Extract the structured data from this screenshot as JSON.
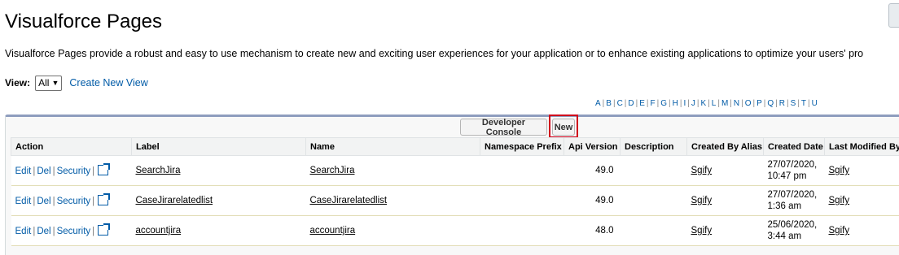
{
  "page": {
    "title": "Visualforce Pages",
    "description": "Visualforce Pages provide a robust and easy to use mechanism to create new and exciting user experiences for your application or to enhance existing applications to optimize your users' pro"
  },
  "view": {
    "label": "View:",
    "selected": "All",
    "create_link": "Create New View"
  },
  "alphabet": [
    "A",
    "B",
    "C",
    "D",
    "E",
    "F",
    "G",
    "H",
    "I",
    "J",
    "K",
    "L",
    "M",
    "N",
    "O",
    "P",
    "Q",
    "R",
    "S",
    "T",
    "U"
  ],
  "buttons": {
    "developer_console": "Developer Console",
    "new": "New"
  },
  "table": {
    "headers": [
      "Action",
      "Label",
      "Name",
      "Namespace Prefix",
      "Api Version",
      "Description",
      "Created By Alias",
      "Created Date",
      "Last Modified By"
    ],
    "rows": [
      {
        "actions": [
          "Edit",
          "Del",
          "Security"
        ],
        "label": "SearchJira",
        "name": "SearchJira",
        "namespace": "",
        "api_version": "49.0",
        "description": "",
        "created_by": "Sgify",
        "created_date_line1": "27/07/2020,",
        "created_date_line2": "10:47 pm",
        "modified_by": "Sgify"
      },
      {
        "actions": [
          "Edit",
          "Del",
          "Security"
        ],
        "label": "CaseJirarelatedlist",
        "name": "CaseJirarelatedlist",
        "namespace": "",
        "api_version": "49.0",
        "description": "",
        "created_by": "Sgify",
        "created_date_line1": "27/07/2020,",
        "created_date_line2": "1:36 am",
        "modified_by": "Sgify"
      },
      {
        "actions": [
          "Edit",
          "Del",
          "Security"
        ],
        "label": "accountjira",
        "name": "accountjira",
        "namespace": "",
        "api_version": "48.0",
        "description": "",
        "created_by": "Sgify",
        "created_date_line1": "25/06/2020,",
        "created_date_line2": "3:44 am",
        "modified_by": "Sgify"
      }
    ]
  },
  "colors": {
    "link": "#015ba7",
    "highlight": "#d0021b",
    "list_border": "#8e9dbe"
  },
  "icons": {
    "popout": "external-link-icon",
    "dropdown": "chevron-down-icon"
  }
}
